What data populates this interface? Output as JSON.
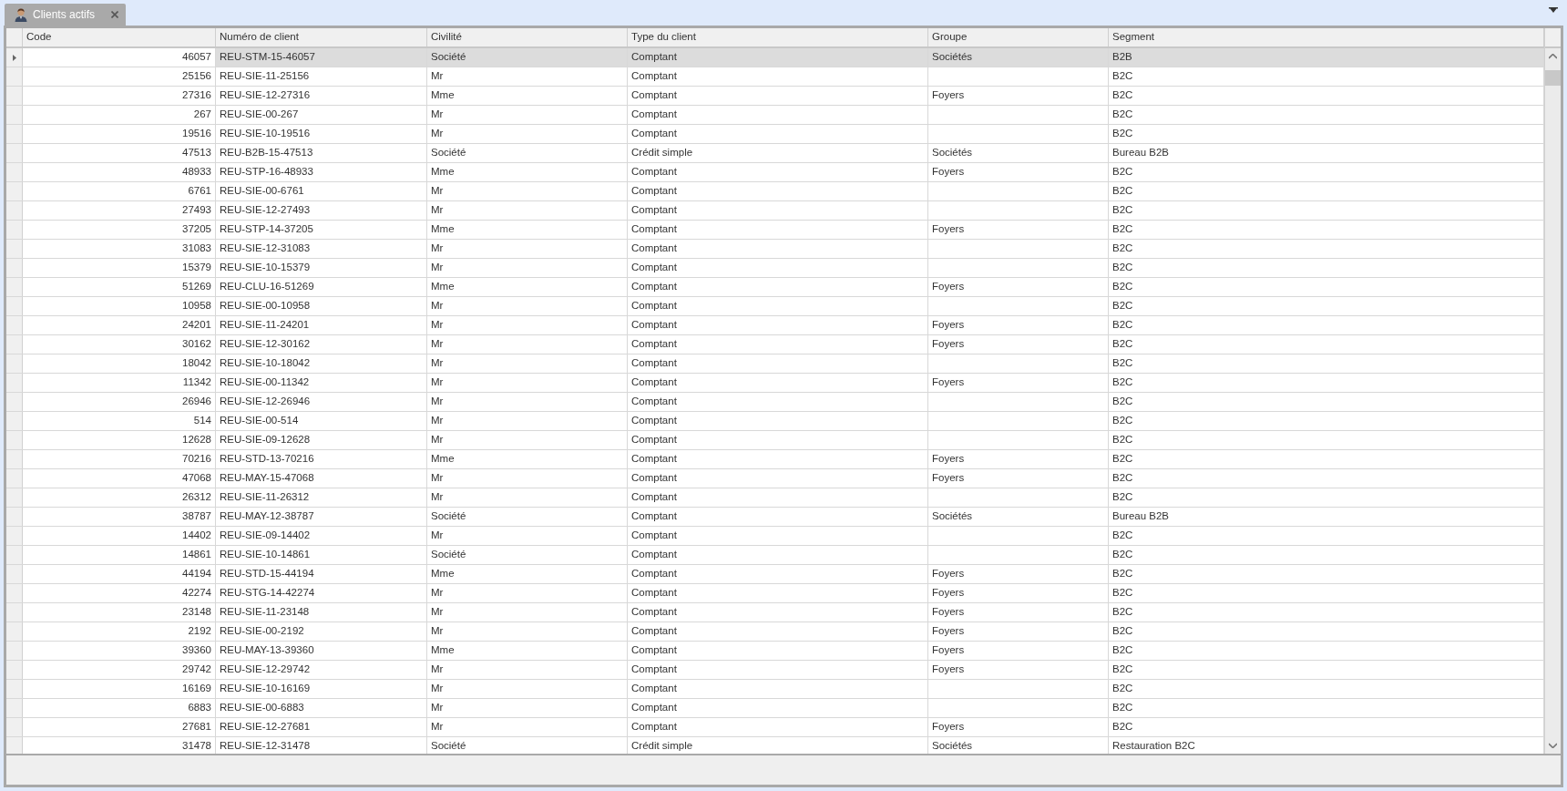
{
  "tabs": [
    {
      "label": "Clients actifs",
      "selected": true
    }
  ],
  "table": {
    "columns": [
      "Code",
      "Numéro de client",
      "Civilité",
      "Type du client",
      "Groupe",
      "Segment"
    ],
    "rows": [
      {
        "selected": true,
        "code": "46057",
        "numero": "REU-STM-15-46057",
        "civilite": "Société",
        "type": "Comptant",
        "groupe": "Sociétés",
        "segment": "B2B"
      },
      {
        "selected": false,
        "code": "25156",
        "numero": "REU-SIE-11-25156",
        "civilite": "Mr",
        "type": "Comptant",
        "segment": "B2C"
      },
      {
        "selected": false,
        "code": "27316",
        "numero": "REU-SIE-12-27316",
        "civilite": "Mme",
        "type": "Comptant",
        "groupe": "Foyers",
        "segment": "B2C"
      },
      {
        "selected": false,
        "code": "267",
        "numero": "REU-SIE-00-267",
        "civilite": "Mr",
        "type": "Comptant",
        "segment": "B2C"
      },
      {
        "selected": false,
        "code": "19516",
        "numero": "REU-SIE-10-19516",
        "civilite": "Mr",
        "type": "Comptant",
        "segment": "B2C"
      },
      {
        "selected": false,
        "code": "47513",
        "numero": "REU-B2B-15-47513",
        "civilite": "Société",
        "type": "Crédit simple",
        "groupe": "Sociétés",
        "segment": "Bureau B2B"
      },
      {
        "selected": false,
        "code": "48933",
        "numero": "REU-STP-16-48933",
        "civilite": "Mme",
        "type": "Comptant",
        "groupe": "Foyers",
        "segment": "B2C"
      },
      {
        "selected": false,
        "code": "6761",
        "numero": "REU-SIE-00-6761",
        "civilite": "Mr",
        "type": "Comptant",
        "segment": "B2C"
      },
      {
        "selected": false,
        "code": "27493",
        "numero": "REU-SIE-12-27493",
        "civilite": "Mr",
        "type": "Comptant",
        "segment": "B2C"
      },
      {
        "selected": false,
        "code": "37205",
        "numero": "REU-STP-14-37205",
        "civilite": "Mme",
        "type": "Comptant",
        "groupe": "Foyers",
        "segment": "B2C"
      },
      {
        "selected": false,
        "code": "31083",
        "numero": "REU-SIE-12-31083",
        "civilite": "Mr",
        "type": "Comptant",
        "segment": "B2C"
      },
      {
        "selected": false,
        "code": "15379",
        "numero": "REU-SIE-10-15379",
        "civilite": "Mr",
        "type": "Comptant",
        "segment": "B2C"
      },
      {
        "selected": false,
        "code": "51269",
        "numero": "REU-CLU-16-51269",
        "civilite": "Mme",
        "type": "Comptant",
        "groupe": "Foyers",
        "segment": "B2C"
      },
      {
        "selected": false,
        "code": "10958",
        "numero": "REU-SIE-00-10958",
        "civilite": "Mr",
        "type": "Comptant",
        "segment": "B2C"
      },
      {
        "selected": false,
        "code": "24201",
        "numero": "REU-SIE-11-24201",
        "civilite": "Mr",
        "type": "Comptant",
        "groupe": "Foyers",
        "segment": "B2C"
      },
      {
        "selected": false,
        "code": "30162",
        "numero": "REU-SIE-12-30162",
        "civilite": "Mr",
        "type": "Comptant",
        "groupe": "Foyers",
        "segment": "B2C"
      },
      {
        "selected": false,
        "code": "18042",
        "numero": "REU-SIE-10-18042",
        "civilite": "Mr",
        "type": "Comptant",
        "segment": "B2C"
      },
      {
        "selected": false,
        "code": "11342",
        "numero": "REU-SIE-00-11342",
        "civilite": "Mr",
        "type": "Comptant",
        "groupe": "Foyers",
        "segment": "B2C"
      },
      {
        "selected": false,
        "code": "26946",
        "numero": "REU-SIE-12-26946",
        "civilite": "Mr",
        "type": "Comptant",
        "segment": "B2C"
      },
      {
        "selected": false,
        "code": "514",
        "numero": "REU-SIE-00-514",
        "civilite": "Mr",
        "type": "Comptant",
        "segment": "B2C"
      },
      {
        "selected": false,
        "code": "12628",
        "numero": "REU-SIE-09-12628",
        "civilite": "Mr",
        "type": "Comptant",
        "segment": "B2C"
      },
      {
        "selected": false,
        "code": "70216",
        "numero": "REU-STD-13-70216",
        "civilite": "Mme",
        "type": "Comptant",
        "groupe": "Foyers",
        "segment": "B2C"
      },
      {
        "selected": false,
        "code": "47068",
        "numero": "REU-MAY-15-47068",
        "civilite": "Mr",
        "type": "Comptant",
        "groupe": "Foyers",
        "segment": "B2C"
      },
      {
        "selected": false,
        "code": "26312",
        "numero": "REU-SIE-11-26312",
        "civilite": "Mr",
        "type": "Comptant",
        "segment": "B2C"
      },
      {
        "selected": false,
        "code": "38787",
        "numero": "REU-MAY-12-38787",
        "civilite": "Société",
        "type": "Comptant",
        "groupe": "Sociétés",
        "segment": "Bureau B2B"
      },
      {
        "selected": false,
        "code": "14402",
        "numero": "REU-SIE-09-14402",
        "civilite": "Mr",
        "type": "Comptant",
        "segment": "B2C"
      },
      {
        "selected": false,
        "code": "14861",
        "numero": "REU-SIE-10-14861",
        "civilite": "Société",
        "type": "Comptant",
        "segment": "B2C"
      },
      {
        "selected": false,
        "code": "44194",
        "numero": "REU-STD-15-44194",
        "civilite": "Mme",
        "type": "Comptant",
        "groupe": "Foyers",
        "segment": "B2C"
      },
      {
        "selected": false,
        "code": "42274",
        "numero": "REU-STG-14-42274",
        "civilite": "Mr",
        "type": "Comptant",
        "groupe": "Foyers",
        "segment": "B2C"
      },
      {
        "selected": false,
        "code": "23148",
        "numero": "REU-SIE-11-23148",
        "civilite": "Mr",
        "type": "Comptant",
        "groupe": "Foyers",
        "segment": "B2C"
      },
      {
        "selected": false,
        "code": "2192",
        "numero": "REU-SIE-00-2192",
        "civilite": "Mr",
        "type": "Comptant",
        "groupe": "Foyers",
        "segment": "B2C"
      },
      {
        "selected": false,
        "code": "39360",
        "numero": "REU-MAY-13-39360",
        "civilite": "Mme",
        "type": "Comptant",
        "groupe": "Foyers",
        "segment": "B2C"
      },
      {
        "selected": false,
        "code": "29742",
        "numero": "REU-SIE-12-29742",
        "civilite": "Mr",
        "type": "Comptant",
        "groupe": "Foyers",
        "segment": "B2C"
      },
      {
        "selected": false,
        "code": "16169",
        "numero": "REU-SIE-10-16169",
        "civilite": "Mr",
        "type": "Comptant",
        "segment": "B2C"
      },
      {
        "selected": false,
        "code": "6883",
        "numero": "REU-SIE-00-6883",
        "civilite": "Mr",
        "type": "Comptant",
        "segment": "B2C"
      },
      {
        "selected": false,
        "code": "27681",
        "numero": "REU-SIE-12-27681",
        "civilite": "Mr",
        "type": "Comptant",
        "groupe": "Foyers",
        "segment": "B2C"
      },
      {
        "selected": false,
        "code": "31478",
        "numero": "REU-SIE-12-31478",
        "civilite": "Société",
        "type": "Crédit simple",
        "groupe": "Sociétés",
        "segment": "Restauration B2C"
      }
    ]
  }
}
